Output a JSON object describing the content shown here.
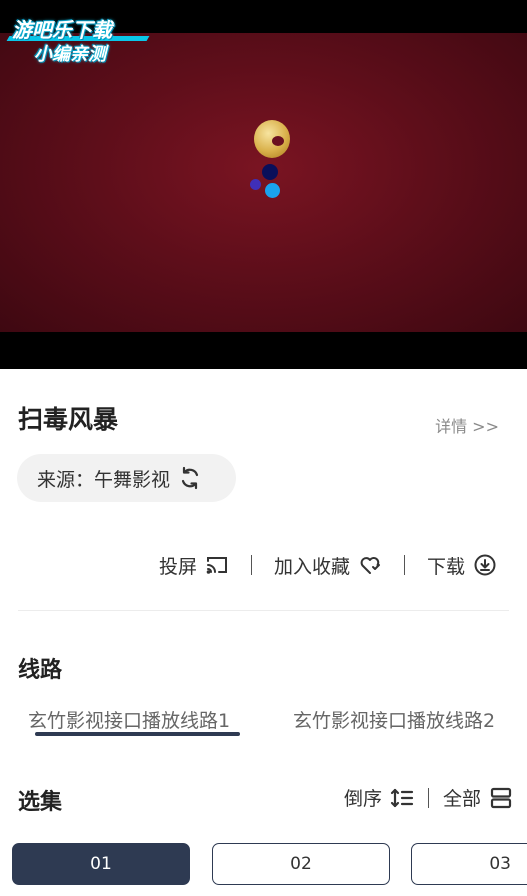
{
  "watermark": {
    "line1": "游吧乐下载",
    "line2": "小编亲测"
  },
  "video": {
    "title": "扫毒风暴",
    "details_label": "详情 >>"
  },
  "source": {
    "label": "来源：午舞影视",
    "icon": "refresh-icon"
  },
  "actions": {
    "cast_label": "投屏",
    "cast_icon": "cast-icon",
    "favorite_label": "加入收藏",
    "favorite_icon": "heart-icon",
    "download_label": "下载",
    "download_icon": "download-icon"
  },
  "routes": {
    "heading": "线路",
    "items": [
      {
        "label": "玄竹影视接口播放线路1",
        "selected": true
      },
      {
        "label": "玄竹影视接口播放线路2",
        "selected": false
      }
    ]
  },
  "episodes": {
    "heading": "选集",
    "order_label": "倒序",
    "all_label": "全部",
    "items": [
      {
        "label": "01",
        "selected": true
      },
      {
        "label": "02",
        "selected": false
      },
      {
        "label": "03",
        "selected": false
      }
    ]
  },
  "colors": {
    "accent": "#2e3a52",
    "video_bg": "#5e0e1a"
  }
}
